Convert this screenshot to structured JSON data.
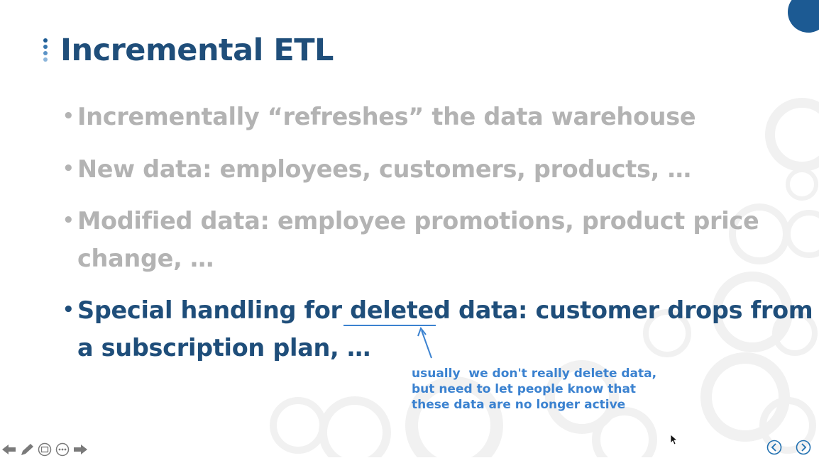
{
  "slide": {
    "title": "Incremental ETL",
    "bullets": [
      {
        "text": "Incrementally “refreshes” the data warehouse",
        "state": "dim"
      },
      {
        "text": "New data: employees, customers, products, …",
        "state": "dim"
      },
      {
        "text": "Modified data: employee promotions, product price change, …",
        "state": "dim"
      },
      {
        "text": "Special handling for deleted data: customer drops from a subscription plan, …",
        "state": "active"
      }
    ],
    "bullet_symbol": "•",
    "bullet_line1": [
      "Modified data: employee promotions, product price",
      "change, …"
    ],
    "bullet_active_lines": [
      "Special handling for deleted data: customer drops from",
      "a subscription plan, …"
    ],
    "annotation": "usually  we don't really delete data,\nbut need to let people know that\nthese data are no longer active"
  },
  "colors": {
    "title": "#1f4e7a",
    "active_text": "#1f4e7a",
    "dim_text": "#b3b3b3",
    "annotation": "#3b82d0",
    "accent_circle": "#1c5a93"
  },
  "toolbar": {
    "icons": [
      "arrow-left-icon",
      "pen-icon",
      "slides-icon",
      "more-icon",
      "arrow-right-icon"
    ]
  },
  "navigation": {
    "icons": [
      "previous-slide-icon",
      "next-slide-icon"
    ]
  }
}
